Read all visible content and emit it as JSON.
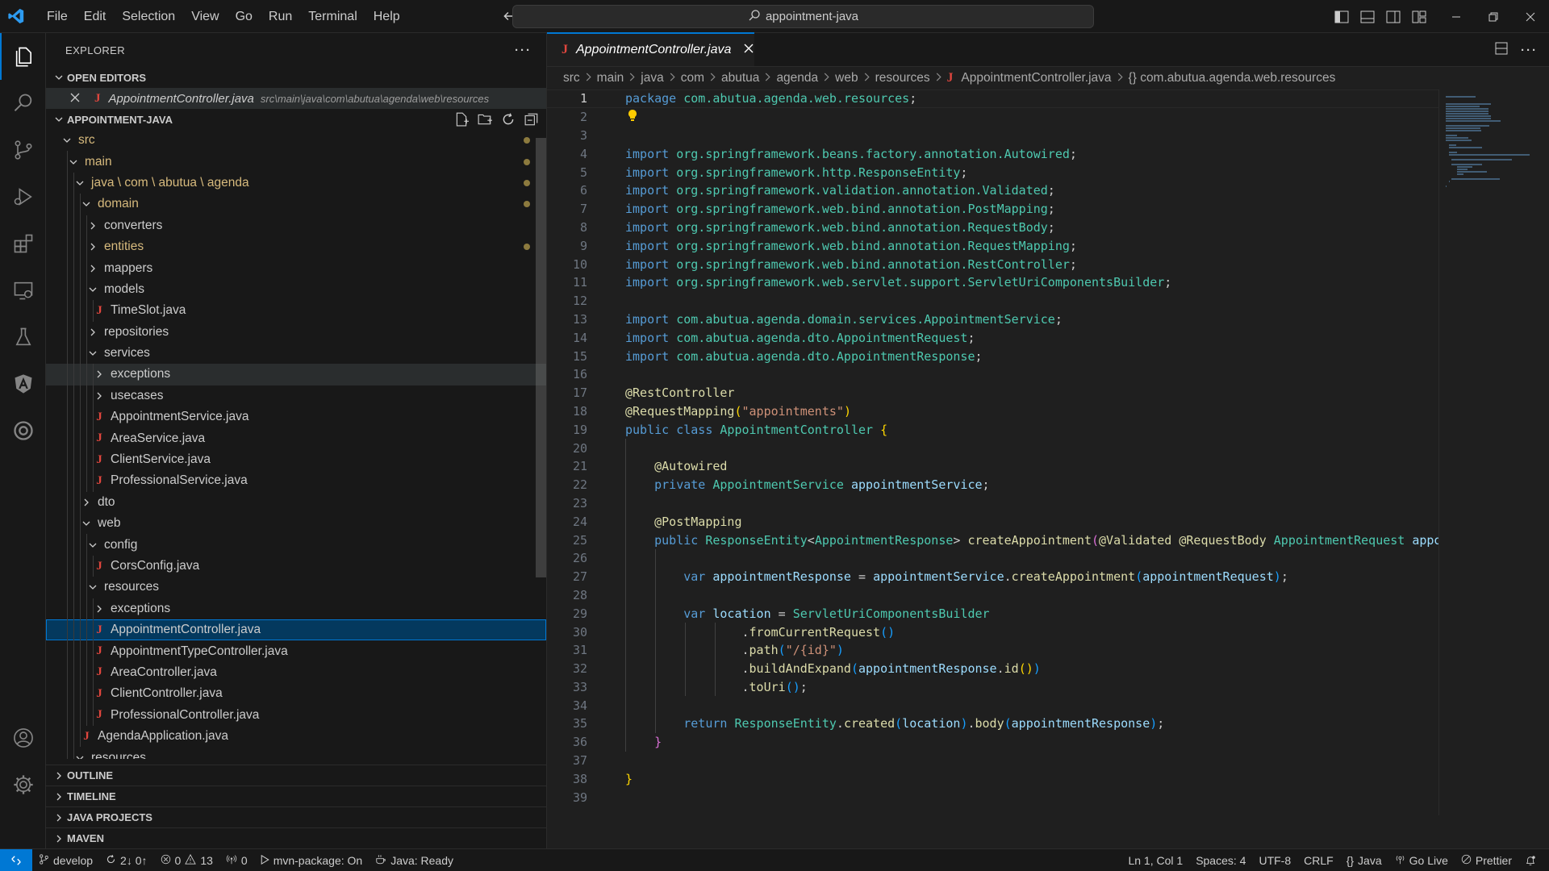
{
  "titlebar": {
    "menu": [
      "File",
      "Edit",
      "Selection",
      "View",
      "Go",
      "Run",
      "Terminal",
      "Help"
    ],
    "search_text": "appointment-java"
  },
  "explorer": {
    "title": "EXPLORER",
    "open_editors_label": "OPEN EDITORS",
    "open_editor_file": "AppointmentController.java",
    "open_editor_path": "src\\main\\java\\com\\abutua\\agenda\\web\\resources",
    "project_label": "APPOINTMENT-JAVA",
    "tree": [
      {
        "label": "src",
        "depth": 0,
        "type": "folder-open",
        "mod": true
      },
      {
        "label": "main",
        "depth": 1,
        "type": "folder-open",
        "mod": true
      },
      {
        "label": "java \\ com \\ abutua \\ agenda",
        "depth": 2,
        "type": "folder-open",
        "mod": true
      },
      {
        "label": "domain",
        "depth": 3,
        "type": "folder-open",
        "mod": true
      },
      {
        "label": "converters",
        "depth": 4,
        "type": "folder",
        "mod": false
      },
      {
        "label": "entities",
        "depth": 4,
        "type": "folder",
        "mod": true
      },
      {
        "label": "mappers",
        "depth": 4,
        "type": "folder",
        "mod": false
      },
      {
        "label": "models",
        "depth": 4,
        "type": "folder-open",
        "mod": false
      },
      {
        "label": "TimeSlot.java",
        "depth": 5,
        "type": "java",
        "mod": false
      },
      {
        "label": "repositories",
        "depth": 4,
        "type": "folder",
        "mod": false
      },
      {
        "label": "services",
        "depth": 4,
        "type": "folder-open",
        "mod": false
      },
      {
        "label": "exceptions",
        "depth": 5,
        "type": "folder",
        "mod": false,
        "hover": true
      },
      {
        "label": "usecases",
        "depth": 5,
        "type": "folder",
        "mod": false
      },
      {
        "label": "AppointmentService.java",
        "depth": 5,
        "type": "java",
        "mod": false
      },
      {
        "label": "AreaService.java",
        "depth": 5,
        "type": "java",
        "mod": false
      },
      {
        "label": "ClientService.java",
        "depth": 5,
        "type": "java",
        "mod": false
      },
      {
        "label": "ProfessionalService.java",
        "depth": 5,
        "type": "java",
        "mod": false
      },
      {
        "label": "dto",
        "depth": 3,
        "type": "folder",
        "mod": false
      },
      {
        "label": "web",
        "depth": 3,
        "type": "folder-open",
        "mod": false
      },
      {
        "label": "config",
        "depth": 4,
        "type": "folder-open",
        "mod": false
      },
      {
        "label": "CorsConfig.java",
        "depth": 5,
        "type": "java",
        "mod": false
      },
      {
        "label": "resources",
        "depth": 4,
        "type": "folder-open",
        "mod": false
      },
      {
        "label": "exceptions",
        "depth": 5,
        "type": "folder",
        "mod": false
      },
      {
        "label": "AppointmentController.java",
        "depth": 5,
        "type": "java",
        "mod": false,
        "selected": true
      },
      {
        "label": "AppointmentTypeController.java",
        "depth": 5,
        "type": "java",
        "mod": false
      },
      {
        "label": "AreaController.java",
        "depth": 5,
        "type": "java",
        "mod": false
      },
      {
        "label": "ClientController.java",
        "depth": 5,
        "type": "java",
        "mod": false
      },
      {
        "label": "ProfessionalController.java",
        "depth": 5,
        "type": "java",
        "mod": false
      },
      {
        "label": "AgendaApplication.java",
        "depth": 3,
        "type": "java",
        "mod": false
      },
      {
        "label": "resources",
        "depth": 2,
        "type": "folder-open",
        "mod": false
      }
    ],
    "bottom_sections": [
      "OUTLINE",
      "TIMELINE",
      "JAVA PROJECTS",
      "MAVEN"
    ]
  },
  "editor": {
    "tab_label": "AppointmentController.java",
    "breadcrumbs": [
      "src",
      "main",
      "java",
      "com",
      "abutua",
      "agenda",
      "web",
      "resources",
      "AppointmentController.java",
      "{} com.abutua.agenda.web.resources"
    ],
    "active_line": 1,
    "lines": [
      [
        [
          "kw",
          "package "
        ],
        [
          "pk",
          "com.abutua.agenda.web.resources"
        ],
        [
          "",
          "; "
        ]
      ],
      [
        [
          "bulb",
          ""
        ]
      ],
      [],
      [
        [
          "kw",
          "import "
        ],
        [
          "pk",
          "org.springframework.beans.factory.annotation.Autowired"
        ],
        [
          "",
          ";"
        ]
      ],
      [
        [
          "kw",
          "import "
        ],
        [
          "pk",
          "org.springframework.http.ResponseEntity"
        ],
        [
          "",
          ";"
        ]
      ],
      [
        [
          "kw",
          "import "
        ],
        [
          "pk",
          "org.springframework.validation.annotation.Validated"
        ],
        [
          "",
          ";"
        ]
      ],
      [
        [
          "kw",
          "import "
        ],
        [
          "pk",
          "org.springframework.web.bind.annotation.PostMapping"
        ],
        [
          "",
          ";"
        ]
      ],
      [
        [
          "kw",
          "import "
        ],
        [
          "pk",
          "org.springframework.web.bind.annotation.RequestBody"
        ],
        [
          "",
          ";"
        ]
      ],
      [
        [
          "kw",
          "import "
        ],
        [
          "pk",
          "org.springframework.web.bind.annotation.RequestMapping"
        ],
        [
          "",
          ";"
        ]
      ],
      [
        [
          "kw",
          "import "
        ],
        [
          "pk",
          "org.springframework.web.bind.annotation.RestController"
        ],
        [
          "",
          ";"
        ]
      ],
      [
        [
          "kw",
          "import "
        ],
        [
          "pk",
          "org.springframework.web.servlet.support.ServletUriComponentsBuilder"
        ],
        [
          "",
          ";"
        ]
      ],
      [],
      [
        [
          "kw",
          "import "
        ],
        [
          "pk",
          "com.abutua.agenda.domain.services.AppointmentService"
        ],
        [
          "",
          ";"
        ]
      ],
      [
        [
          "kw",
          "import "
        ],
        [
          "pk",
          "com.abutua.agenda.dto.AppointmentRequest"
        ],
        [
          "",
          ";"
        ]
      ],
      [
        [
          "kw",
          "import "
        ],
        [
          "pk",
          "com.abutua.agenda.dto.AppointmentResponse"
        ],
        [
          "",
          ";"
        ]
      ],
      [],
      [
        [
          "an",
          "@RestController"
        ]
      ],
      [
        [
          "an",
          "@RequestMapping"
        ],
        [
          "br",
          "("
        ],
        [
          "str",
          "\"appointments\""
        ],
        [
          "br",
          ")"
        ]
      ],
      [
        [
          "kw",
          "public "
        ],
        [
          "kw",
          "class "
        ],
        [
          "ty",
          "AppointmentController "
        ],
        [
          "br",
          "{"
        ]
      ],
      [],
      [
        [
          "",
          "    "
        ],
        [
          "an",
          "@Autowired"
        ]
      ],
      [
        [
          "",
          "    "
        ],
        [
          "kw",
          "private "
        ],
        [
          "ty",
          "AppointmentService "
        ],
        [
          "var",
          "appointmentService"
        ],
        [
          "",
          ";"
        ]
      ],
      [],
      [
        [
          "",
          "    "
        ],
        [
          "an",
          "@PostMapping"
        ]
      ],
      [
        [
          "",
          "    "
        ],
        [
          "kw",
          "public "
        ],
        [
          "ty",
          "ResponseEntity"
        ],
        [
          "",
          "<"
        ],
        [
          "ty",
          "AppointmentResponse"
        ],
        [
          "",
          "> "
        ],
        [
          "fn",
          "createAppointment"
        ],
        [
          "br2",
          "("
        ],
        [
          "an",
          "@Validated "
        ],
        [
          "an",
          "@RequestBody "
        ],
        [
          "ty",
          "AppointmentRequest "
        ],
        [
          "var",
          "appointmentRequest"
        ],
        [
          "br2",
          ")"
        ],
        [
          "",
          " "
        ],
        [
          "br2",
          "{"
        ]
      ],
      [],
      [
        [
          "",
          "        "
        ],
        [
          "kw",
          "var "
        ],
        [
          "var",
          "appointmentResponse"
        ],
        [
          "",
          " = "
        ],
        [
          "var",
          "appointmentService"
        ],
        [
          "",
          "."
        ],
        [
          "fn",
          "createAppointment"
        ],
        [
          "br3",
          "("
        ],
        [
          "var",
          "appointmentRequest"
        ],
        [
          "br3",
          ")"
        ],
        [
          "",
          ";"
        ]
      ],
      [],
      [
        [
          "",
          "        "
        ],
        [
          "kw",
          "var "
        ],
        [
          "var",
          "location"
        ],
        [
          "",
          " = "
        ],
        [
          "ty",
          "ServletUriComponentsBuilder"
        ]
      ],
      [
        [
          "",
          "                "
        ],
        [
          "",
          "."
        ],
        [
          "fn",
          "fromCurrentRequest"
        ],
        [
          "br3",
          "()"
        ]
      ],
      [
        [
          "",
          "                "
        ],
        [
          "",
          "."
        ],
        [
          "fn",
          "path"
        ],
        [
          "br3",
          "("
        ],
        [
          "str",
          "\"/{id}\""
        ],
        [
          "br3",
          ")"
        ]
      ],
      [
        [
          "",
          "                "
        ],
        [
          "",
          "."
        ],
        [
          "fn",
          "buildAndExpand"
        ],
        [
          "br3",
          "("
        ],
        [
          "var",
          "appointmentResponse"
        ],
        [
          "",
          "."
        ],
        [
          "fn",
          "id"
        ],
        [
          "br",
          "()"
        ],
        [
          "br3",
          ")"
        ]
      ],
      [
        [
          "",
          "                "
        ],
        [
          "",
          "."
        ],
        [
          "fn",
          "toUri"
        ],
        [
          "br3",
          "()"
        ],
        [
          "",
          ";"
        ]
      ],
      [],
      [
        [
          "",
          "        "
        ],
        [
          "kw",
          "return "
        ],
        [
          "ty",
          "ResponseEntity"
        ],
        [
          "",
          "."
        ],
        [
          "fn",
          "created"
        ],
        [
          "br3",
          "("
        ],
        [
          "var",
          "location"
        ],
        [
          "br3",
          ")"
        ],
        [
          "",
          "."
        ],
        [
          "fn",
          "body"
        ],
        [
          "br3",
          "("
        ],
        [
          "var",
          "appointmentResponse"
        ],
        [
          "br3",
          ")"
        ],
        [
          "",
          ";"
        ]
      ],
      [
        [
          "",
          "    "
        ],
        [
          "br2",
          "}"
        ]
      ],
      [],
      [
        [
          "br",
          "}"
        ]
      ],
      []
    ]
  },
  "statusbar": {
    "branch": "develop",
    "sync": "2↓ 0↑",
    "errors": "0",
    "warnings": "13",
    "ports": "0",
    "task": "mvn-package: On",
    "java_status": "Java: Ready",
    "position": "Ln 1, Col 1",
    "spaces": "Spaces: 4",
    "encoding": "UTF-8",
    "eol": "CRLF",
    "language": "Java",
    "golive": "Go Live",
    "prettier": "Prettier"
  },
  "colors": {
    "accent": "#0078d4",
    "java_icon": "#e1463e",
    "modified": "#d7ba7d"
  }
}
